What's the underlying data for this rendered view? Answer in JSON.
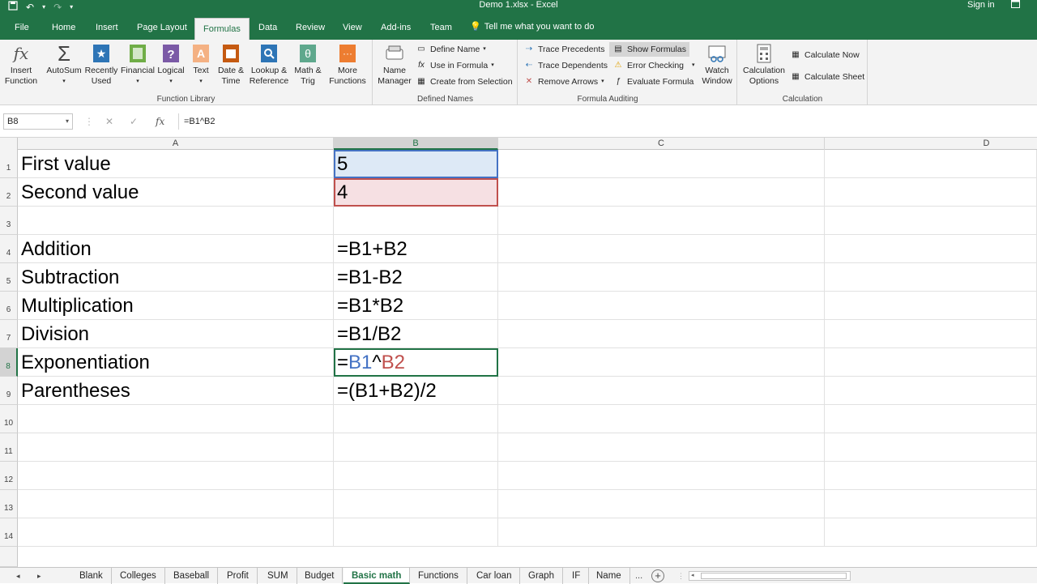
{
  "window": {
    "title": "Demo 1.xlsx - Excel",
    "signin": "Sign in"
  },
  "tabs": [
    "File",
    "Home",
    "Insert",
    "Page Layout",
    "Formulas",
    "Data",
    "Review",
    "View",
    "Add-ins",
    "Team"
  ],
  "active_tab": "Formulas",
  "tell_me": "Tell me what you want to do",
  "ribbon": {
    "function_library": {
      "label": "Function Library",
      "insert_function": [
        "Insert",
        "Function"
      ],
      "autosum": "AutoSum",
      "recently_used": [
        "Recently",
        "Used"
      ],
      "financial": "Financial",
      "logical": "Logical",
      "text": "Text",
      "date_time": [
        "Date &",
        "Time"
      ],
      "lookup_reference": [
        "Lookup &",
        "Reference"
      ],
      "math_trig": [
        "Math &",
        "Trig"
      ],
      "more_functions": [
        "More",
        "Functions"
      ]
    },
    "defined_names": {
      "label": "Defined Names",
      "name_manager": [
        "Name",
        "Manager"
      ],
      "define_name": "Define Name",
      "use_in_formula": "Use in Formula",
      "create_from_selection": "Create from Selection"
    },
    "formula_auditing": {
      "label": "Formula Auditing",
      "trace_precedents": "Trace Precedents",
      "trace_dependents": "Trace Dependents",
      "remove_arrows": "Remove Arrows",
      "show_formulas": "Show Formulas",
      "error_checking": "Error Checking",
      "evaluate_formula": "Evaluate Formula",
      "watch_window": [
        "Watch",
        "Window"
      ]
    },
    "calculation": {
      "label": "Calculation",
      "calculation_options": [
        "Calculation",
        "Options"
      ],
      "calculate_now": "Calculate Now",
      "calculate_sheet": "Calculate Sheet"
    }
  },
  "formula_bar": {
    "name_box": "B8",
    "formula": "=B1^B2",
    "fx": "fx"
  },
  "columns": [
    "A",
    "B",
    "C",
    "D"
  ],
  "rows": [
    {
      "num": "1",
      "a": "First value",
      "b": "5"
    },
    {
      "num": "2",
      "a": "Second value",
      "b": "4"
    },
    {
      "num": "3",
      "a": "",
      "b": ""
    },
    {
      "num": "4",
      "a": "Addition",
      "b": "=B1+B2"
    },
    {
      "num": "5",
      "a": "Subtraction",
      "b": "=B1-B2"
    },
    {
      "num": "6",
      "a": "Multiplication",
      "b": "=B1*B2"
    },
    {
      "num": "7",
      "a": "Division",
      "b": "=B1/B2"
    },
    {
      "num": "8",
      "a": "Exponentiation",
      "b_parts": [
        "=",
        "B1",
        "^",
        "B2"
      ]
    },
    {
      "num": "9",
      "a": "Parentheses",
      "b": "=(B1+B2)/2"
    },
    {
      "num": "10",
      "a": "",
      "b": ""
    },
    {
      "num": "11",
      "a": "",
      "b": ""
    },
    {
      "num": "12",
      "a": "",
      "b": ""
    },
    {
      "num": "13",
      "a": "",
      "b": ""
    },
    {
      "num": "14",
      "a": "",
      "b": ""
    }
  ],
  "sheets": [
    "Blank",
    "Colleges",
    "Baseball",
    "Profit",
    "SUM",
    "Budget",
    "Basic math",
    "Functions",
    "Car loan",
    "Graph",
    "IF",
    "Name"
  ],
  "active_sheet": "Basic math",
  "sheet_more": "...",
  "colors": {
    "excel_green": "#217346",
    "ref_blue": "#4472c4",
    "ref_red": "#c0504d"
  }
}
